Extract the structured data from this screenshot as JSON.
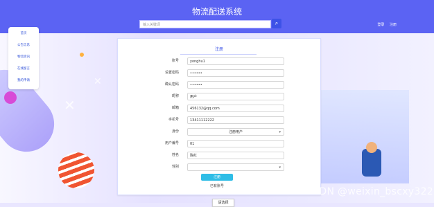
{
  "app": {
    "title": "物流配送系统"
  },
  "search": {
    "placeholder": "输入关键词",
    "button_icon": "search-icon"
  },
  "top_links": [
    {
      "label": "登录"
    },
    {
      "label": "注册"
    }
  ],
  "sidebar": {
    "items": [
      {
        "label": "首页"
      },
      {
        "label": "公告信息"
      },
      {
        "label": "物流资讯"
      },
      {
        "label": "在线留言"
      },
      {
        "label": "我的申请"
      }
    ]
  },
  "form": {
    "title": "注册",
    "fields": [
      {
        "label": "账号",
        "value": "yonghu1",
        "type": "input"
      },
      {
        "label": "设置密码",
        "value": "••••••",
        "type": "password"
      },
      {
        "label": "确认密码",
        "value": "••••••",
        "type": "password"
      },
      {
        "label": "昵称",
        "value": "用户",
        "type": "input"
      },
      {
        "label": "邮箱",
        "value": "456132@qq.com",
        "type": "input"
      },
      {
        "label": "手机号",
        "value": "13411112222",
        "type": "input"
      },
      {
        "label": "身份",
        "value": "注册用户",
        "type": "select"
      },
      {
        "label": "用户编号",
        "value": "01",
        "type": "input"
      },
      {
        "label": "姓名",
        "value": "陈红",
        "type": "input"
      },
      {
        "label": "性别",
        "value": "",
        "type": "select"
      }
    ],
    "dropdown_option": "请选择",
    "submit_label": "注册",
    "login_link": "已有账号"
  },
  "colors": {
    "header": "#5b63f3",
    "primary": "#3b52e6",
    "submit": "#2fbde6",
    "bg": "#e9e6ff"
  },
  "watermark": "CSDN @weixin_bscxy322"
}
